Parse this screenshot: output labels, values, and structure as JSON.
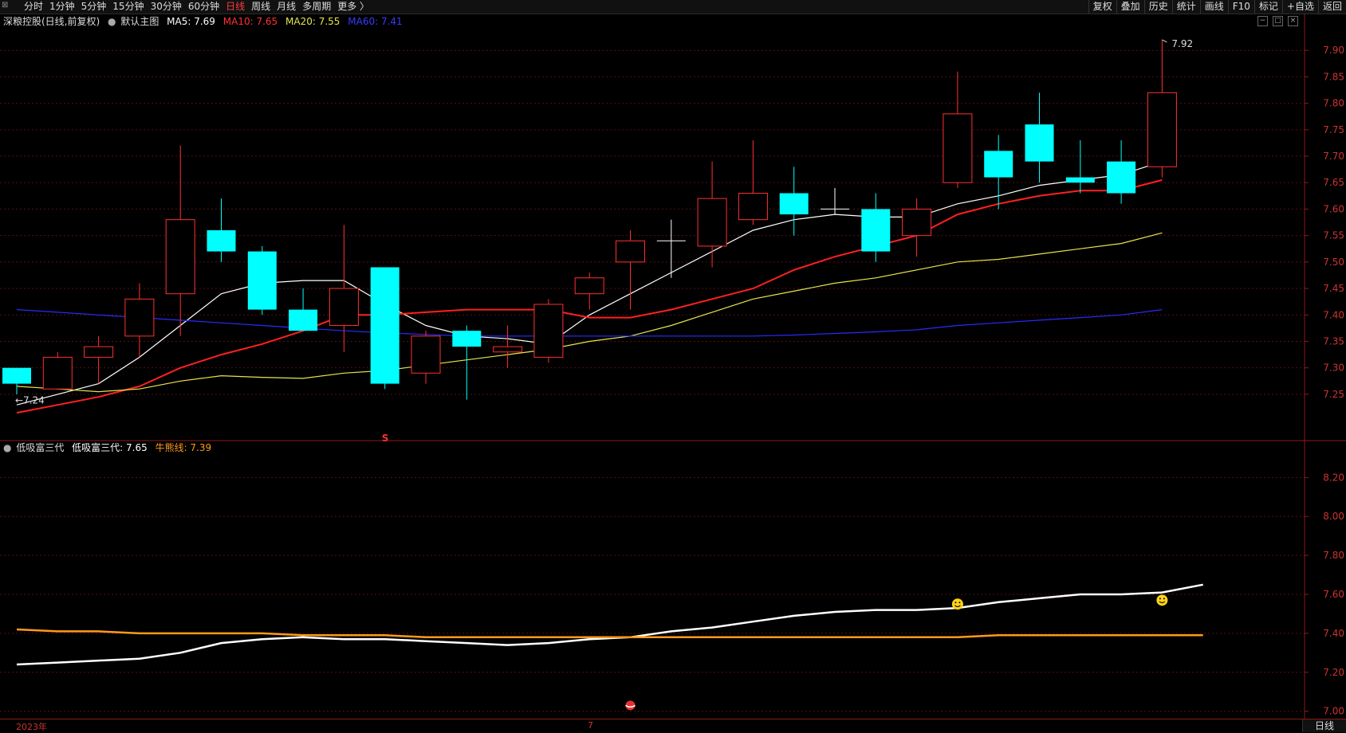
{
  "toolbar": {
    "periods": [
      "分时",
      "1分钟",
      "5分钟",
      "15分钟",
      "30分钟",
      "60分钟",
      "日线",
      "周线",
      "月线",
      "多周期",
      "更多 〉"
    ],
    "active_period": "日线",
    "right_tools": [
      "复权",
      "叠加",
      "历史",
      "统计",
      "画线",
      "F10",
      "标记",
      "+自选",
      "返回"
    ]
  },
  "main_legend": {
    "stock": "深粮控股(日线,前复权)",
    "template": "默认主图",
    "ma5": "MA5: 7.69",
    "ma10": "MA10: 7.65",
    "ma20": "MA20: 7.55",
    "ma60": "MA60: 7.41",
    "colors": {
      "ma5": "#ffffff",
      "ma10": "#ff2020",
      "ma20": "#e6e64c",
      "ma60": "#2a2aff"
    }
  },
  "sub_legend": {
    "name": "低吸富三代",
    "value": "低吸富三代: 7.65",
    "bull": "牛熊线: 7.39",
    "colors": {
      "line": "#ffffff",
      "bull": "#ff9a1a"
    }
  },
  "bottom": {
    "year_label": "2023年",
    "month_label": "7",
    "period_label": "日线"
  },
  "chart_data": [
    {
      "type": "candlestick",
      "ylim": [
        7.17,
        7.95
      ],
      "yticks": [
        7.25,
        7.3,
        7.35,
        7.4,
        7.45,
        7.5,
        7.55,
        7.6,
        7.65,
        7.7,
        7.75,
        7.8,
        7.85,
        7.9
      ],
      "high_label": "7.92",
      "low_label": "←7.24",
      "marker": "S",
      "candles": [
        {
          "o": 7.3,
          "h": 7.3,
          "l": 7.25,
          "c": 7.27
        },
        {
          "o": 7.26,
          "h": 7.33,
          "l": 7.26,
          "c": 7.32
        },
        {
          "o": 7.32,
          "h": 7.36,
          "l": 7.27,
          "c": 7.34
        },
        {
          "o": 7.36,
          "h": 7.46,
          "l": 7.32,
          "c": 7.43
        },
        {
          "o": 7.44,
          "h": 7.72,
          "l": 7.36,
          "c": 7.58
        },
        {
          "o": 7.56,
          "h": 7.62,
          "l": 7.5,
          "c": 7.52
        },
        {
          "o": 7.52,
          "h": 7.53,
          "l": 7.4,
          "c": 7.41
        },
        {
          "o": 7.41,
          "h": 7.45,
          "l": 7.37,
          "c": 7.37
        },
        {
          "o": 7.38,
          "h": 7.57,
          "l": 7.33,
          "c": 7.45
        },
        {
          "o": 7.49,
          "h": 7.49,
          "l": 7.26,
          "c": 7.27
        },
        {
          "o": 7.29,
          "h": 7.37,
          "l": 7.27,
          "c": 7.36
        },
        {
          "o": 7.37,
          "h": 7.38,
          "l": 7.24,
          "c": 7.34
        },
        {
          "o": 7.33,
          "h": 7.38,
          "l": 7.3,
          "c": 7.34
        },
        {
          "o": 7.32,
          "h": 7.43,
          "l": 7.31,
          "c": 7.42
        },
        {
          "o": 7.44,
          "h": 7.48,
          "l": 7.41,
          "c": 7.47
        },
        {
          "o": 7.5,
          "h": 7.56,
          "l": 7.41,
          "c": 7.54
        },
        {
          "o": 7.54,
          "h": 7.58,
          "l": 7.47,
          "c": 7.54
        },
        {
          "o": 7.53,
          "h": 7.69,
          "l": 7.49,
          "c": 7.62
        },
        {
          "o": 7.58,
          "h": 7.73,
          "l": 7.57,
          "c": 7.63
        },
        {
          "o": 7.63,
          "h": 7.68,
          "l": 7.55,
          "c": 7.59
        },
        {
          "o": 7.6,
          "h": 7.64,
          "l": 7.59,
          "c": 7.6
        },
        {
          "o": 7.6,
          "h": 7.63,
          "l": 7.5,
          "c": 7.52
        },
        {
          "o": 7.55,
          "h": 7.62,
          "l": 7.51,
          "c": 7.6
        },
        {
          "o": 7.65,
          "h": 7.86,
          "l": 7.64,
          "c": 7.78
        },
        {
          "o": 7.71,
          "h": 7.74,
          "l": 7.6,
          "c": 7.66
        },
        {
          "o": 7.76,
          "h": 7.82,
          "l": 7.65,
          "c": 7.69
        },
        {
          "o": 7.66,
          "h": 7.73,
          "l": 7.63,
          "c": 7.65
        },
        {
          "o": 7.69,
          "h": 7.73,
          "l": 7.61,
          "c": 7.63
        },
        {
          "o": 7.68,
          "h": 7.92,
          "l": 7.66,
          "c": 7.82
        }
      ],
      "series": [
        {
          "name": "MA5",
          "color": "#ffffff",
          "values": [
            7.23,
            7.25,
            7.27,
            7.32,
            7.38,
            7.44,
            7.46,
            7.465,
            7.465,
            7.42,
            7.38,
            7.36,
            7.355,
            7.345,
            7.4,
            7.44,
            7.48,
            7.52,
            7.56,
            7.58,
            7.59,
            7.585,
            7.585,
            7.61,
            7.625,
            7.645,
            7.655,
            7.665,
            7.69
          ]
        },
        {
          "name": "MA10",
          "color": "#ff2020",
          "values": [
            7.215,
            7.23,
            7.245,
            7.265,
            7.3,
            7.325,
            7.345,
            7.37,
            7.4,
            7.4,
            7.405,
            7.41,
            7.41,
            7.41,
            7.395,
            7.395,
            7.41,
            7.43,
            7.45,
            7.485,
            7.51,
            7.53,
            7.55,
            7.59,
            7.61,
            7.625,
            7.635,
            7.635,
            7.655
          ]
        },
        {
          "name": "MA20",
          "color": "#e6e64c",
          "values": [
            7.265,
            7.26,
            7.255,
            7.26,
            7.275,
            7.285,
            7.282,
            7.28,
            7.29,
            7.295,
            7.305,
            7.315,
            7.325,
            7.335,
            7.35,
            7.36,
            7.38,
            7.405,
            7.43,
            7.445,
            7.46,
            7.47,
            7.485,
            7.5,
            7.505,
            7.515,
            7.525,
            7.535,
            7.555
          ]
        },
        {
          "name": "MA60",
          "color": "#2a2aff",
          "values": [
            7.41,
            7.405,
            7.4,
            7.395,
            7.39,
            7.385,
            7.38,
            7.375,
            7.37,
            7.366,
            7.363,
            7.36,
            7.36,
            7.36,
            7.36,
            7.36,
            7.36,
            7.36,
            7.36,
            7.362,
            7.365,
            7.368,
            7.372,
            7.38,
            7.385,
            7.39,
            7.395,
            7.4,
            7.41
          ]
        }
      ]
    },
    {
      "type": "line",
      "ylim": [
        6.97,
        8.32
      ],
      "yticks": [
        7.0,
        7.2,
        7.4,
        7.6,
        7.8,
        8.0,
        8.2
      ],
      "series": [
        {
          "name": "低吸富三代",
          "color": "#ffffff",
          "values": [
            7.24,
            7.25,
            7.26,
            7.27,
            7.3,
            7.35,
            7.37,
            7.38,
            7.37,
            7.37,
            7.36,
            7.35,
            7.34,
            7.35,
            7.37,
            7.38,
            7.41,
            7.43,
            7.46,
            7.49,
            7.51,
            7.52,
            7.52,
            7.53,
            7.56,
            7.58,
            7.6,
            7.6,
            7.61,
            7.65
          ]
        },
        {
          "name": "牛熊线",
          "color": "#ff9a1a",
          "values": [
            7.42,
            7.41,
            7.41,
            7.4,
            7.4,
            7.4,
            7.4,
            7.39,
            7.39,
            7.39,
            7.38,
            7.38,
            7.38,
            7.38,
            7.38,
            7.38,
            7.38,
            7.38,
            7.38,
            7.38,
            7.38,
            7.38,
            7.38,
            7.38,
            7.39,
            7.39,
            7.39,
            7.39,
            7.39,
            7.39
          ]
        }
      ],
      "markers": [
        {
          "type": "ball-icon",
          "index": 15,
          "value": 7.03
        },
        {
          "type": "smiley-icon",
          "index": 23,
          "value": 7.55
        },
        {
          "type": "smiley-icon",
          "index": 28,
          "value": 7.57
        }
      ]
    }
  ]
}
